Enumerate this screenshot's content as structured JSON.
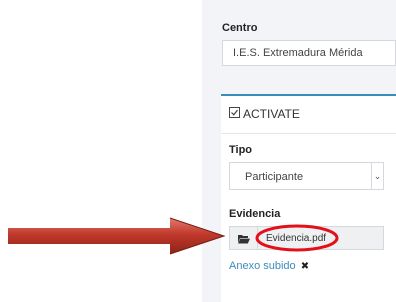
{
  "form": {
    "centro_label": "Centro",
    "centro_value": "I.E.S. Extremadura Mérida"
  },
  "box": {
    "title": "ACTIVATE",
    "tipo_label": "Tipo",
    "tipo_value": "Participante",
    "evidencia_label": "Evidencia",
    "file_name": "Evidencia.pdf",
    "annex_link": "Anexo subido",
    "remove_glyph": "✖"
  },
  "icons": {
    "title": "checkbox-icon",
    "file": "folder-open-icon",
    "caret": "chevron-down-icon"
  },
  "colors": {
    "accent": "#3c8dbc",
    "arrow": "#c0392b",
    "highlight_circle": "#e3101a"
  }
}
